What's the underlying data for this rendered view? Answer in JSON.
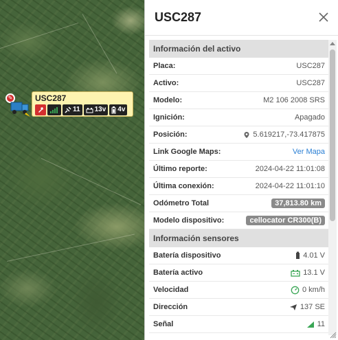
{
  "map": {
    "marker": {
      "plate": "USC287",
      "badges": {
        "signal_count": "11",
        "vehicle_voltage": "13v",
        "device_voltage": "4v"
      }
    }
  },
  "panel": {
    "title": "USC287",
    "sections": [
      {
        "title": "Información del activo",
        "rows": [
          {
            "label": "Placa:",
            "value": "USC287"
          },
          {
            "label": "Activo:",
            "value": "USC287"
          },
          {
            "label": "Modelo:",
            "value": "M2 106 2008 SRS"
          },
          {
            "label": "Ignición:",
            "value": "Apagado"
          },
          {
            "label": "Posición:",
            "value": "5.619217,-73.417875",
            "icon": "location-pin-icon"
          },
          {
            "label": "Link Google Maps:",
            "value": "Ver Mapa"
          },
          {
            "label": "Último reporte:",
            "value": "2024-04-22 11:01:08"
          },
          {
            "label": "Última conexión:",
            "value": "2024-04-22 11:01:10"
          },
          {
            "label": "Odómetro Total",
            "value": "37,813.80 km"
          },
          {
            "label": "Modelo dispositivo:",
            "value": "cellocator CR300(B)"
          }
        ]
      },
      {
        "title": "Información sensores",
        "rows": [
          {
            "label": "Batería dispositivo",
            "value": "4.01 V",
            "icon": "battery-icon"
          },
          {
            "label": "Batería activo",
            "value": "13.1 V",
            "icon": "car-battery-icon"
          },
          {
            "label": "Velocidad",
            "value": "0 km/h",
            "icon": "speedometer-icon"
          },
          {
            "label": "Dirección",
            "value": "137 SE",
            "icon": "direction-arrow-icon"
          },
          {
            "label": "Señal",
            "value": "11",
            "icon": "signal-icon"
          }
        ]
      }
    ]
  },
  "colors": {
    "link": "#2a7fd4",
    "pill": "#8a8a8a",
    "tooltip_bg": "#fdf3b0",
    "section_bg": "#e0e0e0",
    "sensor_green": "#3aa655"
  }
}
